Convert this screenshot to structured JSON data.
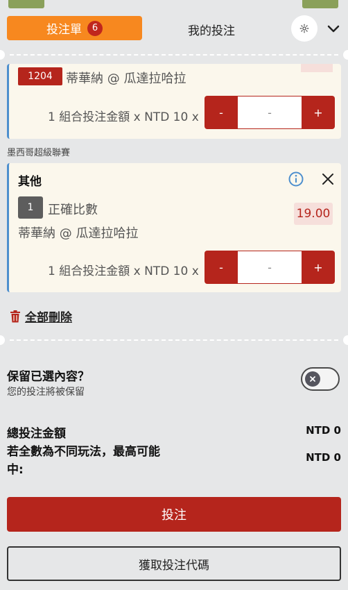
{
  "header": {
    "active_tab_label": "投注單",
    "active_tab_count": "6",
    "my_bets_label": "我的投注",
    "settings_icon": "gear-icon",
    "collapse_icon": "chevron-down-icon"
  },
  "bets": [
    {
      "selection_id": "1204",
      "match": "蒂華納 @ 瓜達拉哈拉",
      "stake_label": "1 組合投注金額 x NTD 10 x",
      "stake_minus": "-",
      "stake_value": "-",
      "stake_plus": "+"
    },
    {
      "league": "墨西哥超級聯賽",
      "market_title": "其他",
      "selection_number": "1",
      "selection_name": "正確比數",
      "match": "蒂華納 @ 瓜達拉哈拉",
      "odds": "19.00",
      "stake_label": "1 組合投注金額 x NTD 10 x",
      "stake_minus": "-",
      "stake_value": "-",
      "stake_plus": "+"
    }
  ],
  "actions": {
    "clear_all": "全部刪除",
    "keep_title": "保留已選內容？",
    "keep_subtitle": "您的投注將被保留",
    "place_bet": "投注",
    "get_code": "獲取投注代碼"
  },
  "summary": {
    "total_label": "總投注金額",
    "total_value": "NTD 0",
    "max_win_label_line1": "若全數為不同玩法，最高可能",
    "max_win_label_line2": "中:",
    "max_win_value": "NTD 0"
  },
  "colors": {
    "accent_orange": "#f7881f",
    "brand_red": "#b5251c",
    "info_blue": "#4d8fce",
    "card_bg": "#fbf7ec"
  }
}
